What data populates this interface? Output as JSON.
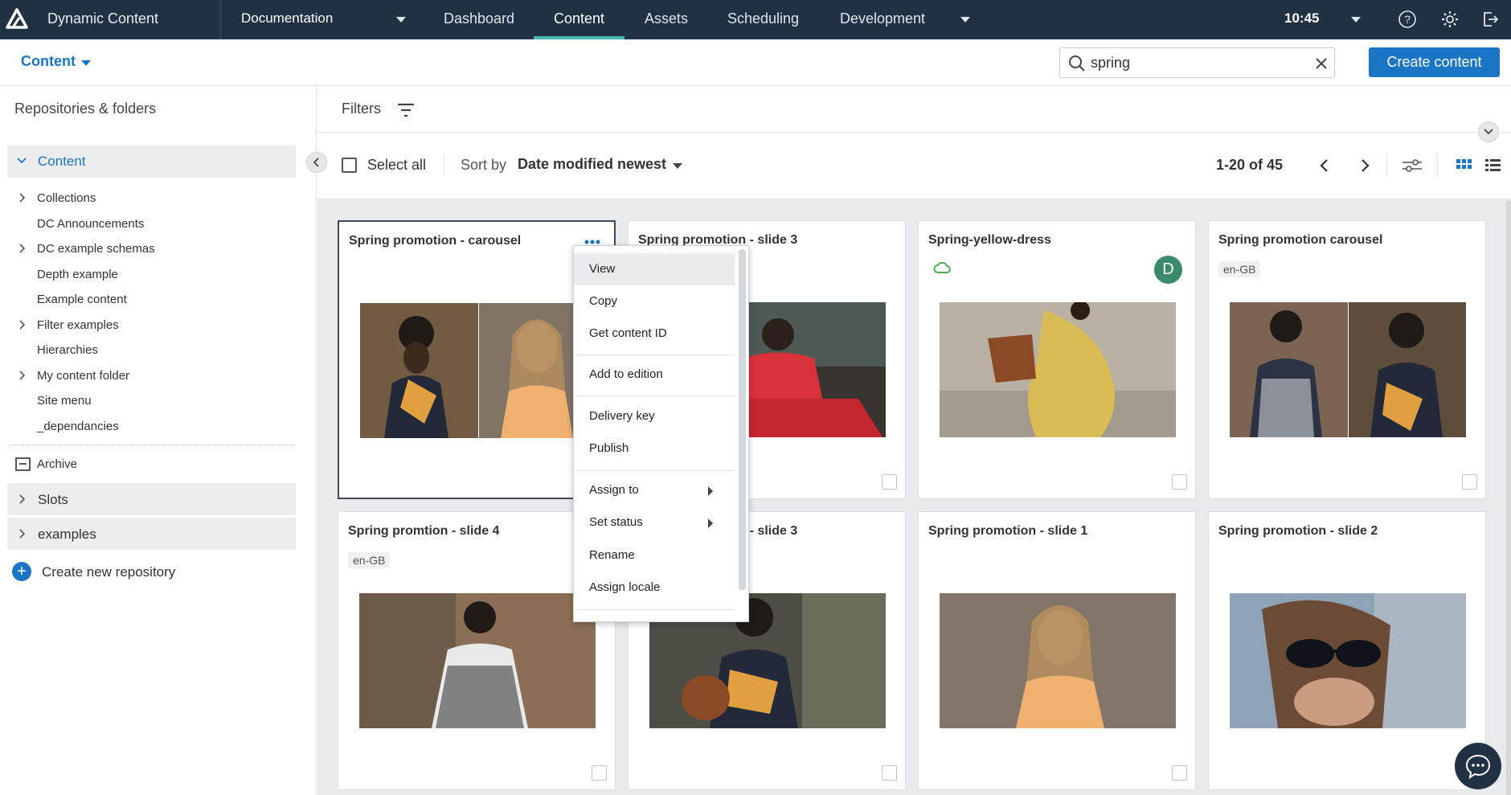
{
  "header": {
    "app_name": "Dynamic Content",
    "hub": "Documentation",
    "tabs": [
      {
        "label": "Dashboard"
      },
      {
        "label": "Content"
      },
      {
        "label": "Assets"
      },
      {
        "label": "Scheduling"
      },
      {
        "label": "Development"
      }
    ],
    "time": "10:45",
    "icons": [
      "help-icon",
      "settings-icon",
      "logout-icon"
    ]
  },
  "subheader": {
    "section": "Content",
    "search_value": "spring",
    "create_label": "Create content"
  },
  "sidebar": {
    "title": "Repositories & folders",
    "root": "Content",
    "folders": [
      {
        "label": "Collections",
        "expandable": true
      },
      {
        "label": "DC Announcements",
        "expandable": false
      },
      {
        "label": "DC example schemas",
        "expandable": true
      },
      {
        "label": "Depth example",
        "expandable": false
      },
      {
        "label": "Example content",
        "expandable": false
      },
      {
        "label": "Filter examples",
        "expandable": true
      },
      {
        "label": "Hierarchies",
        "expandable": false
      },
      {
        "label": "My content folder",
        "expandable": true
      },
      {
        "label": "Site menu",
        "expandable": false
      },
      {
        "label": "_dependancies",
        "expandable": false
      }
    ],
    "archive": "Archive",
    "repositories": [
      "Slots",
      "examples"
    ],
    "create_repo": "Create new repository"
  },
  "toolbar": {
    "filters": "Filters",
    "select_all": "Select all",
    "sort_by": "Sort by",
    "sort_value": "Date modified newest",
    "pagination": "1-20 of 45"
  },
  "cards": [
    {
      "title": "Spring promotion - carousel",
      "badge": "",
      "selected": true
    },
    {
      "title": "Spring promotion - slide 3",
      "badge": ""
    },
    {
      "title": "Spring-yellow-dress",
      "badge": "",
      "avatar": "D"
    },
    {
      "title": "Spring promotion carousel",
      "badge": "en-GB"
    },
    {
      "title": "Spring promtion - slide 4",
      "badge": "en-GB"
    },
    {
      "title": "Spring promotion - slide 3",
      "badge": ""
    },
    {
      "title": "Spring promotion - slide 1",
      "badge": ""
    },
    {
      "title": "Spring promotion - slide 2",
      "badge": ""
    }
  ],
  "context_menu": {
    "items": [
      "View",
      "Copy",
      "Get content ID",
      "Add to edition",
      "Delivery key",
      "Publish",
      "Assign to",
      "Set status",
      "Rename",
      "Assign locale"
    ]
  },
  "colors": {
    "topbar": "#1f3142",
    "accent": "#1a75c4",
    "active_tab_underline": "#4db6ac"
  }
}
